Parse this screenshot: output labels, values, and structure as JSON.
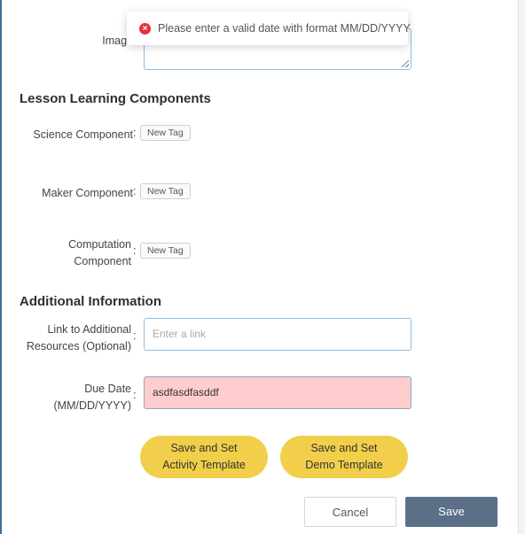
{
  "toast": {
    "message": "Please enter a valid date with format MM/DD/YYYY"
  },
  "image_field": {
    "label": "Image"
  },
  "sections": {
    "learning": "Lesson Learning Components",
    "additional": "Additional Information"
  },
  "components": [
    {
      "label": "Science Component",
      "tag": "New Tag"
    },
    {
      "label": "Maker Component",
      "tag": "New Tag"
    },
    {
      "label_line1": "Computation",
      "label_line2": "Component",
      "tag": "New Tag"
    }
  ],
  "colon": ":",
  "link_field": {
    "label_line1": "Link to Additional",
    "label_line2": "Resources (Optional)",
    "placeholder": "Enter a link"
  },
  "due_field": {
    "label_line1": "Due Date",
    "label_line2": "(MM/DD/YYYY)",
    "value": "asdfasdfasddf"
  },
  "buttons": {
    "activity_line1": "Save and Set",
    "activity_line2": "Activity Template",
    "demo_line1": "Save and Set",
    "demo_line2": "Demo Template",
    "cancel": "Cancel",
    "save": "Save"
  },
  "colors": {
    "accent_yellow": "#f1cf4a",
    "save_blue": "#5b7088",
    "error_red": "#e8303a",
    "invalid_bg": "#ffcdcd"
  }
}
